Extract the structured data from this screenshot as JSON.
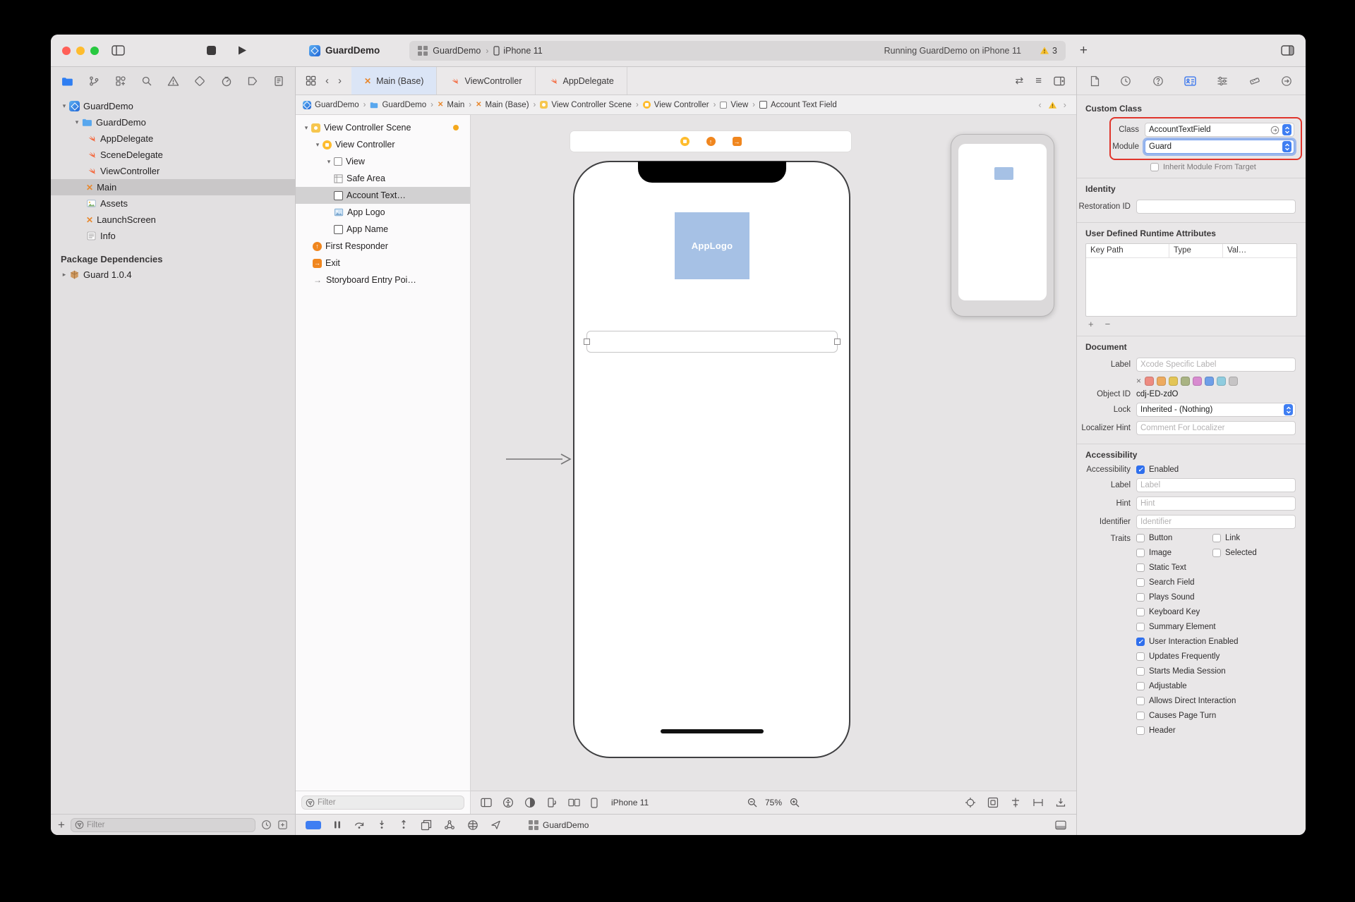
{
  "icons": {
    "disclosure_open": "▾",
    "disclosure_closed": "▸",
    "chevron_left": "‹",
    "chevron_right": "›",
    "crumb_sep": "›",
    "plus": "+",
    "minus": "−",
    "clear_x": "×",
    "storyboard_x": "✕",
    "check": "✓",
    "arrow_up": "↑",
    "arrow_right": "→",
    "list_lines": "≡",
    "swap_arrows": "⇄"
  },
  "titlebar": {
    "project": "GuardDemo",
    "scheme": "GuardDemo",
    "destination": "iPhone 11",
    "status": "Running GuardDemo on iPhone 11",
    "issues": "3"
  },
  "tabs": {
    "items": [
      {
        "label": "Main (Base)"
      },
      {
        "label": "ViewController"
      },
      {
        "label": "AppDelegate"
      }
    ]
  },
  "jumpbar": {
    "crumbs": [
      {
        "label": "GuardDemo"
      },
      {
        "label": "GuardDemo"
      },
      {
        "label": "Main"
      },
      {
        "label": "Main (Base)"
      },
      {
        "label": "View Controller Scene"
      },
      {
        "label": "View Controller"
      },
      {
        "label": "View"
      },
      {
        "label": "Account Text Field"
      }
    ]
  },
  "navigator": {
    "tree": [
      {
        "label": "GuardDemo"
      },
      {
        "label": "GuardDemo"
      },
      {
        "label": "AppDelegate"
      },
      {
        "label": "SceneDelegate"
      },
      {
        "label": "ViewController"
      },
      {
        "label": "Main"
      },
      {
        "label": "Assets"
      },
      {
        "label": "LaunchScreen"
      },
      {
        "label": "Info"
      }
    ],
    "package_section": "Package Dependencies",
    "package_item": "Guard 1.0.4",
    "filter_placeholder": "Filter"
  },
  "outline": {
    "tree": [
      {
        "label": "View Controller Scene"
      },
      {
        "label": "View Controller"
      },
      {
        "label": "View"
      },
      {
        "label": "Safe Area"
      },
      {
        "label": "Account Text…"
      },
      {
        "label": "App Logo"
      },
      {
        "label": "App Name"
      },
      {
        "label": "First Responder"
      },
      {
        "label": "Exit"
      },
      {
        "label": "Storyboard Entry Poi…"
      }
    ],
    "filter_placeholder": "Filter"
  },
  "canvas": {
    "app_logo": "AppLogo",
    "device": "iPhone 11",
    "zoom": "75%"
  },
  "debugbar": {
    "app": "GuardDemo"
  },
  "inspector": {
    "custom_class": {
      "title": "Custom Class",
      "class_label": "Class",
      "class_value": "AccountTextField",
      "module_label": "Module",
      "module_value": "Guard",
      "inherit_label": "Inherit Module From Target"
    },
    "identity": {
      "title": "Identity",
      "restoration_label": "Restoration ID"
    },
    "runtime_attributes": {
      "title": "User Defined Runtime Attributes",
      "col_key": "Key Path",
      "col_type": "Type",
      "col_value": "Val…"
    },
    "document": {
      "title": "Document",
      "label_label": "Label",
      "label_placeholder": "Xcode Specific Label",
      "object_id_label": "Object ID",
      "object_id": "cdj-ED-zdO",
      "lock_label": "Lock",
      "lock_value": "Inherited - (Nothing)",
      "localizer_label": "Localizer Hint",
      "localizer_placeholder": "Comment For Localizer",
      "label_colors": [
        "#ed8b81",
        "#edaa5f",
        "#e3c556",
        "#a9b383",
        "#d88bd0",
        "#6f9fe8",
        "#8fccdf",
        "#c6c4c5"
      ]
    },
    "accessibility": {
      "title": "Accessibility",
      "row_label": "Accessibility",
      "enabled_label": "Enabled",
      "label_label": "Label",
      "label_placeholder": "Label",
      "hint_label": "Hint",
      "hint_placeholder": "Hint",
      "identifier_label": "Identifier",
      "identifier_placeholder": "Identifier",
      "traits_label": "Traits",
      "traits": [
        {
          "label": "Button",
          "checked": false
        },
        {
          "label": "Link",
          "checked": false
        },
        {
          "label": "Image",
          "checked": false
        },
        {
          "label": "Selected",
          "checked": false
        },
        {
          "label": "Static Text",
          "checked": false
        },
        {
          "label": "Search Field",
          "checked": false
        },
        {
          "label": "Plays Sound",
          "checked": false
        },
        {
          "label": "Keyboard Key",
          "checked": false
        },
        {
          "label": "Summary Element",
          "checked": false
        },
        {
          "label": "User Interaction Enabled",
          "checked": true
        },
        {
          "label": "Updates Frequently",
          "checked": false
        },
        {
          "label": "Starts Media Session",
          "checked": false
        },
        {
          "label": "Adjustable",
          "checked": false
        },
        {
          "label": "Allows Direct Interaction",
          "checked": false
        },
        {
          "label": "Causes Page Turn",
          "checked": false
        },
        {
          "label": "Header",
          "checked": false
        }
      ]
    }
  }
}
